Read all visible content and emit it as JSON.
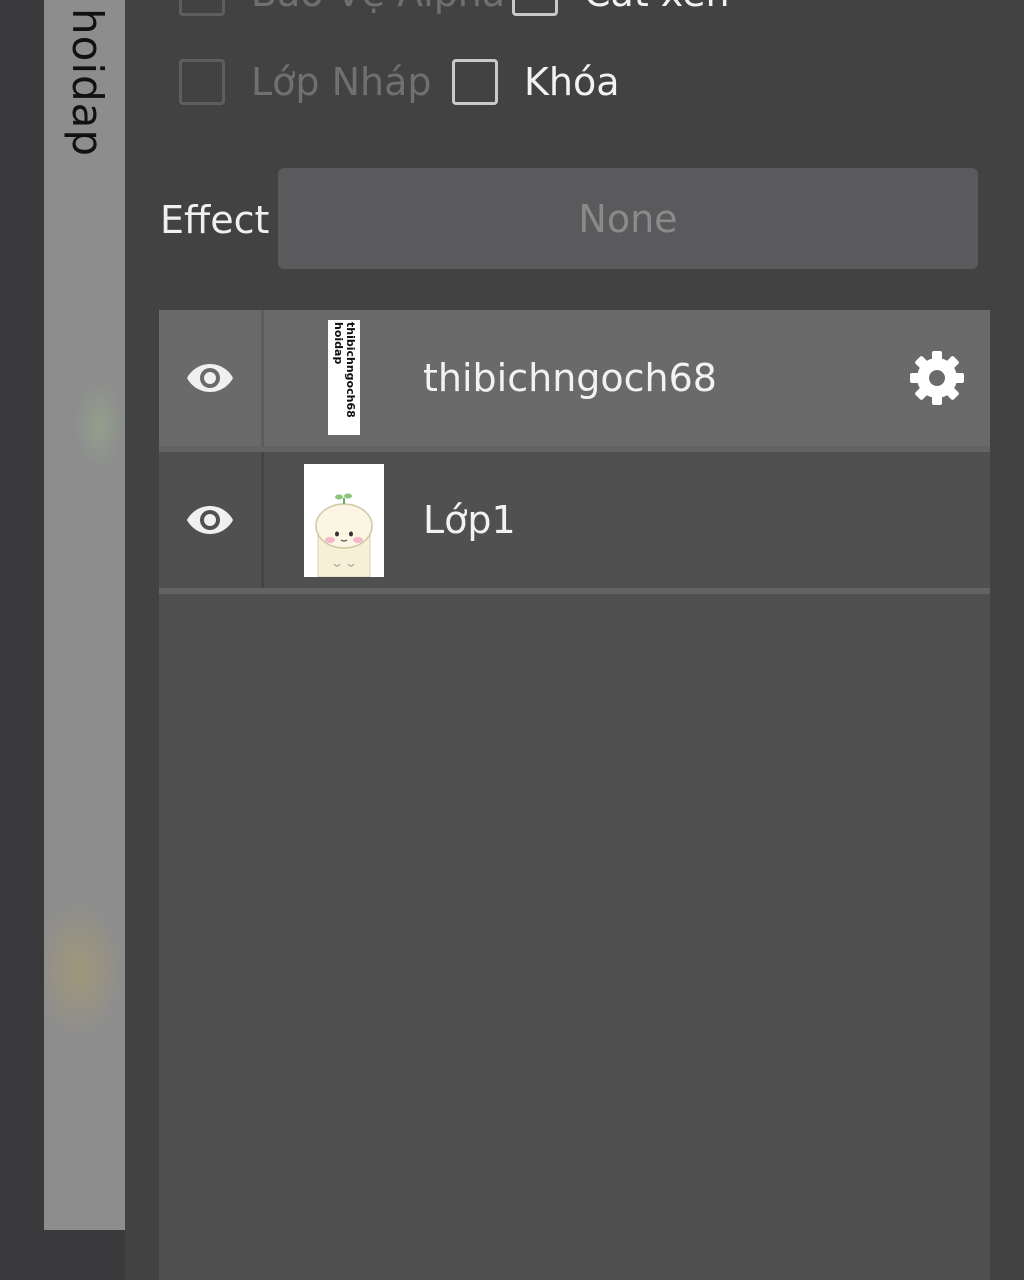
{
  "canvas": {
    "text": "hoidap"
  },
  "options": {
    "row1": [
      {
        "label": "Bảo Vệ Alpha",
        "checked": false,
        "enabled": false
      },
      {
        "label": "Cắt xén",
        "checked": false,
        "enabled": true
      }
    ],
    "row2": [
      {
        "label": "Lớp Nháp",
        "checked": false,
        "enabled": false
      },
      {
        "label": "Khóa",
        "checked": false,
        "enabled": true
      }
    ]
  },
  "effect": {
    "label": "Effect",
    "value": "None"
  },
  "layers": [
    {
      "name": "thibichngoch68",
      "selected": true,
      "visible": true,
      "thumb_text": "thibichngoch68\nhoidap"
    },
    {
      "name": "Lớp1",
      "selected": false,
      "visible": true
    }
  ],
  "colors": {
    "panel": "#424242",
    "selected_row": "#6a6a6a",
    "list_bg": "#505050"
  }
}
